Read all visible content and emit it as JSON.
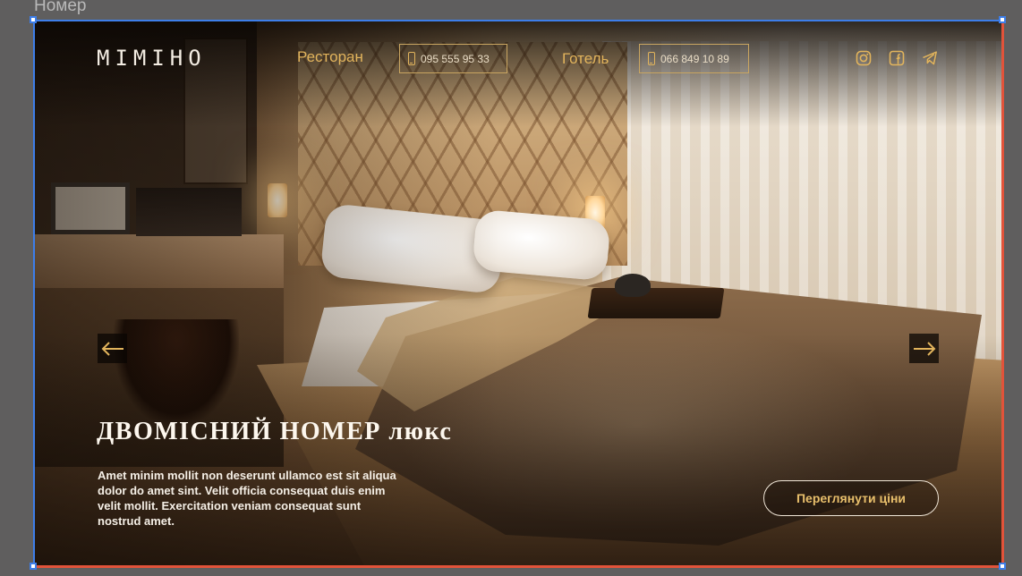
{
  "frame": {
    "title": "Номер"
  },
  "header": {
    "logo": "MIMIHO",
    "restaurant_label": "Ресторан",
    "restaurant_phone": "095 555 95 33",
    "hotel_label": "Готель",
    "hotel_phone": "066 849 10 89",
    "social_icons": [
      "instagram-icon",
      "facebook-icon",
      "telegram-icon"
    ]
  },
  "hero": {
    "title": "ДВОМІСНИЙ НОМЕР люкс",
    "description": "Amet minim mollit non deserunt ullamco est sit aliqua dolor do amet sint. Velit officia consequat duis enim velit mollit. Exercitation veniam consequat sunt nostrud amet.",
    "cta_label": "Переглянути ціни",
    "prev_icon": "arrow-left-icon",
    "next_icon": "arrow-right-icon"
  },
  "colors": {
    "accent": "#e2b45c",
    "canvas": "#5f5e5e",
    "selection": "#3d7ee9",
    "selection_alt": "#e2533a"
  }
}
